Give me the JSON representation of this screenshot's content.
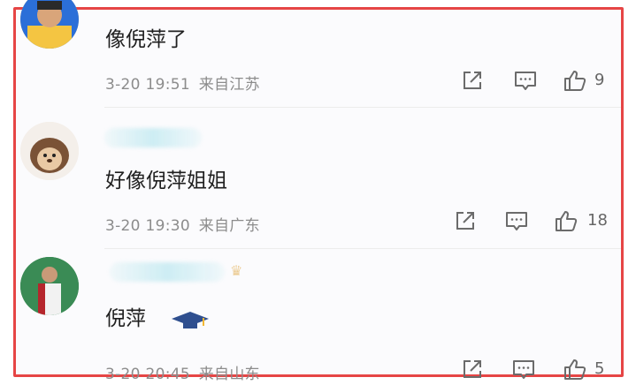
{
  "comments": [
    {
      "text": "像倪萍了",
      "date": "3-20",
      "time": "19:51",
      "location": "来自江苏",
      "likes": "9"
    },
    {
      "text": "好像倪萍姐姐",
      "date": "3-20",
      "time": "19:30",
      "location": "来自广东",
      "likes": "18"
    },
    {
      "text": "倪萍",
      "date": "3-20",
      "time": "20:45",
      "location": "来自山东",
      "likes": "5"
    }
  ],
  "icons": {
    "share": "share-icon",
    "comment": "comment-icon",
    "like": "thumbs-up-icon"
  },
  "colors": {
    "frame_border": "#e64545",
    "meta_text": "#8c8c8c",
    "icon_stroke": "#6b6b6b"
  }
}
